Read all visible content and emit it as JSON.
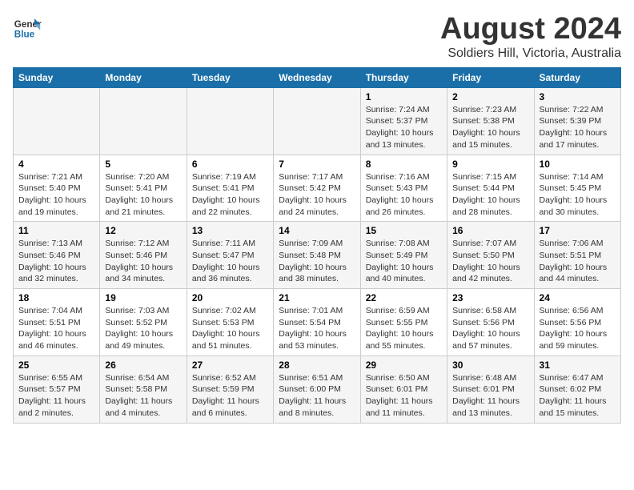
{
  "header": {
    "logo_line1": "General",
    "logo_line2": "Blue",
    "title": "August 2024",
    "subtitle": "Soldiers Hill, Victoria, Australia"
  },
  "columns": [
    "Sunday",
    "Monday",
    "Tuesday",
    "Wednesday",
    "Thursday",
    "Friday",
    "Saturday"
  ],
  "weeks": [
    {
      "days": [
        {
          "num": "",
          "info": ""
        },
        {
          "num": "",
          "info": ""
        },
        {
          "num": "",
          "info": ""
        },
        {
          "num": "",
          "info": ""
        },
        {
          "num": "1",
          "info": "Sunrise: 7:24 AM\nSunset: 5:37 PM\nDaylight: 10 hours\nand 13 minutes."
        },
        {
          "num": "2",
          "info": "Sunrise: 7:23 AM\nSunset: 5:38 PM\nDaylight: 10 hours\nand 15 minutes."
        },
        {
          "num": "3",
          "info": "Sunrise: 7:22 AM\nSunset: 5:39 PM\nDaylight: 10 hours\nand 17 minutes."
        }
      ]
    },
    {
      "days": [
        {
          "num": "4",
          "info": "Sunrise: 7:21 AM\nSunset: 5:40 PM\nDaylight: 10 hours\nand 19 minutes."
        },
        {
          "num": "5",
          "info": "Sunrise: 7:20 AM\nSunset: 5:41 PM\nDaylight: 10 hours\nand 21 minutes."
        },
        {
          "num": "6",
          "info": "Sunrise: 7:19 AM\nSunset: 5:41 PM\nDaylight: 10 hours\nand 22 minutes."
        },
        {
          "num": "7",
          "info": "Sunrise: 7:17 AM\nSunset: 5:42 PM\nDaylight: 10 hours\nand 24 minutes."
        },
        {
          "num": "8",
          "info": "Sunrise: 7:16 AM\nSunset: 5:43 PM\nDaylight: 10 hours\nand 26 minutes."
        },
        {
          "num": "9",
          "info": "Sunrise: 7:15 AM\nSunset: 5:44 PM\nDaylight: 10 hours\nand 28 minutes."
        },
        {
          "num": "10",
          "info": "Sunrise: 7:14 AM\nSunset: 5:45 PM\nDaylight: 10 hours\nand 30 minutes."
        }
      ]
    },
    {
      "days": [
        {
          "num": "11",
          "info": "Sunrise: 7:13 AM\nSunset: 5:46 PM\nDaylight: 10 hours\nand 32 minutes."
        },
        {
          "num": "12",
          "info": "Sunrise: 7:12 AM\nSunset: 5:46 PM\nDaylight: 10 hours\nand 34 minutes."
        },
        {
          "num": "13",
          "info": "Sunrise: 7:11 AM\nSunset: 5:47 PM\nDaylight: 10 hours\nand 36 minutes."
        },
        {
          "num": "14",
          "info": "Sunrise: 7:09 AM\nSunset: 5:48 PM\nDaylight: 10 hours\nand 38 minutes."
        },
        {
          "num": "15",
          "info": "Sunrise: 7:08 AM\nSunset: 5:49 PM\nDaylight: 10 hours\nand 40 minutes."
        },
        {
          "num": "16",
          "info": "Sunrise: 7:07 AM\nSunset: 5:50 PM\nDaylight: 10 hours\nand 42 minutes."
        },
        {
          "num": "17",
          "info": "Sunrise: 7:06 AM\nSunset: 5:51 PM\nDaylight: 10 hours\nand 44 minutes."
        }
      ]
    },
    {
      "days": [
        {
          "num": "18",
          "info": "Sunrise: 7:04 AM\nSunset: 5:51 PM\nDaylight: 10 hours\nand 46 minutes."
        },
        {
          "num": "19",
          "info": "Sunrise: 7:03 AM\nSunset: 5:52 PM\nDaylight: 10 hours\nand 49 minutes."
        },
        {
          "num": "20",
          "info": "Sunrise: 7:02 AM\nSunset: 5:53 PM\nDaylight: 10 hours\nand 51 minutes."
        },
        {
          "num": "21",
          "info": "Sunrise: 7:01 AM\nSunset: 5:54 PM\nDaylight: 10 hours\nand 53 minutes."
        },
        {
          "num": "22",
          "info": "Sunrise: 6:59 AM\nSunset: 5:55 PM\nDaylight: 10 hours\nand 55 minutes."
        },
        {
          "num": "23",
          "info": "Sunrise: 6:58 AM\nSunset: 5:56 PM\nDaylight: 10 hours\nand 57 minutes."
        },
        {
          "num": "24",
          "info": "Sunrise: 6:56 AM\nSunset: 5:56 PM\nDaylight: 10 hours\nand 59 minutes."
        }
      ]
    },
    {
      "days": [
        {
          "num": "25",
          "info": "Sunrise: 6:55 AM\nSunset: 5:57 PM\nDaylight: 11 hours\nand 2 minutes."
        },
        {
          "num": "26",
          "info": "Sunrise: 6:54 AM\nSunset: 5:58 PM\nDaylight: 11 hours\nand 4 minutes."
        },
        {
          "num": "27",
          "info": "Sunrise: 6:52 AM\nSunset: 5:59 PM\nDaylight: 11 hours\nand 6 minutes."
        },
        {
          "num": "28",
          "info": "Sunrise: 6:51 AM\nSunset: 6:00 PM\nDaylight: 11 hours\nand 8 minutes."
        },
        {
          "num": "29",
          "info": "Sunrise: 6:50 AM\nSunset: 6:01 PM\nDaylight: 11 hours\nand 11 minutes."
        },
        {
          "num": "30",
          "info": "Sunrise: 6:48 AM\nSunset: 6:01 PM\nDaylight: 11 hours\nand 13 minutes."
        },
        {
          "num": "31",
          "info": "Sunrise: 6:47 AM\nSunset: 6:02 PM\nDaylight: 11 hours\nand 15 minutes."
        }
      ]
    }
  ]
}
